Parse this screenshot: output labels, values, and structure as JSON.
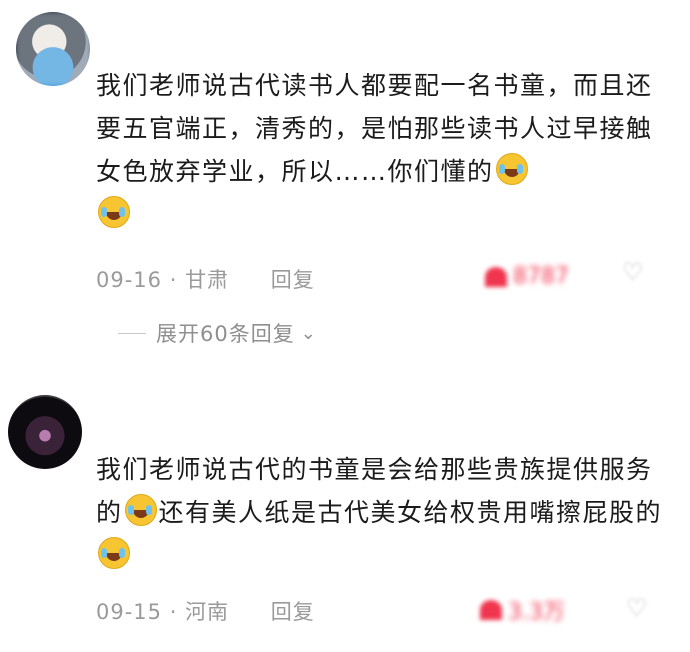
{
  "comments": [
    {
      "text_parts": [
        "我们老师说古代读书人都要配一名书童，而且还要五官端正，清秀的，是怕那些读书人过早接触女色放弃学业，所以……你们懂的",
        "",
        ""
      ],
      "date": "09-16",
      "location": "甘肃",
      "reply_label": "回复",
      "likes": "8787"
    },
    {
      "text_parts": [
        "我们老师说古代的书童是会给那些贵族提供服务的",
        "还有美人纸是古代美女给权贵用嘴擦屁股的",
        ""
      ],
      "date": "09-15",
      "location": "河南",
      "reply_label": "回复",
      "likes": "3.3万"
    }
  ],
  "expand_replies": "展开60条回复",
  "emoji_icon": "laughing-crying-face-icon",
  "like_icon": "heart-icon",
  "dislike_icon": "broken-heart-icon",
  "accent_color": "#f0364f"
}
